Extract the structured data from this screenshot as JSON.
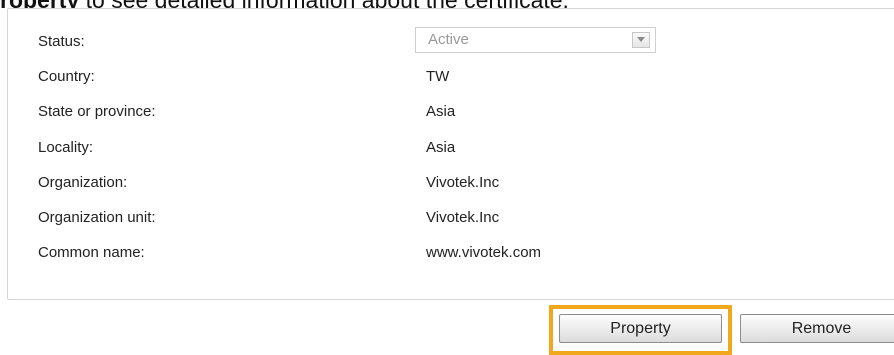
{
  "caption": {
    "bold": "roperty",
    "rest": " to see detailed information about the certificate."
  },
  "form": {
    "rows": [
      {
        "label": "Status:",
        "value": "Active"
      },
      {
        "label": "Country:",
        "value": "TW"
      },
      {
        "label": "State or province:",
        "value": "Asia"
      },
      {
        "label": "Locality:",
        "value": "Asia"
      },
      {
        "label": "Organization:",
        "value": "Vivotek.Inc"
      },
      {
        "label": "Organization unit:",
        "value": "Vivotek.Inc"
      },
      {
        "label": "Common name:",
        "value": "www.vivotek.com"
      }
    ]
  },
  "buttons": {
    "property": "Property",
    "remove": "Remove"
  },
  "colors": {
    "highlight": "#f2a81d",
    "border": "#d6d6d6"
  },
  "icons": {
    "status_dropdown": "chevron-down-icon"
  }
}
